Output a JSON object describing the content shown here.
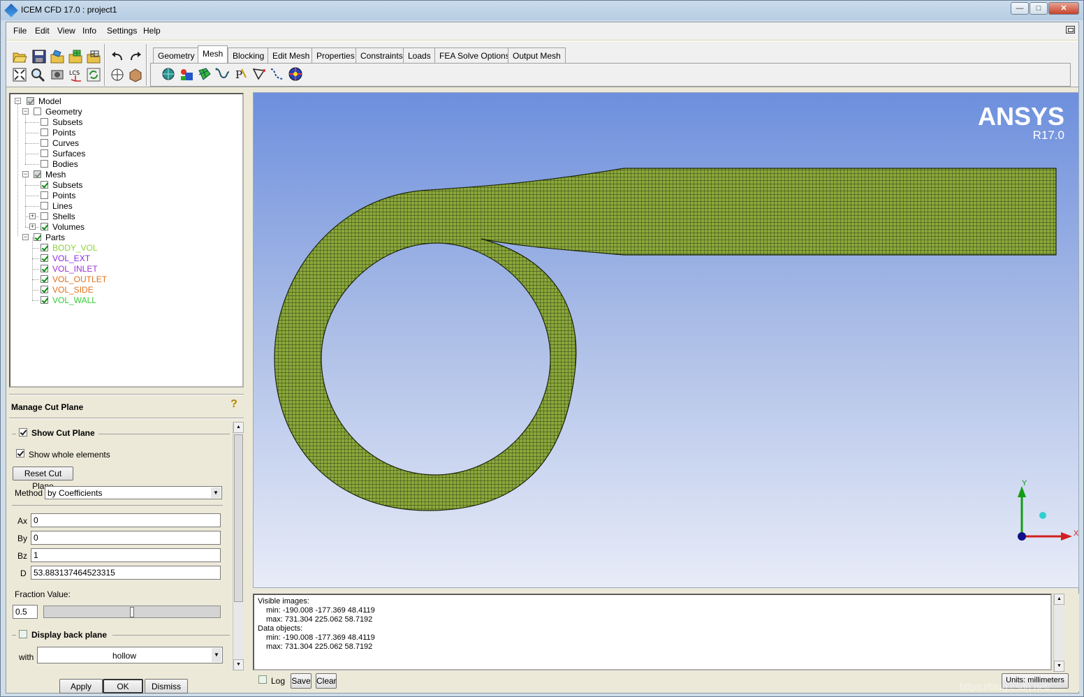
{
  "window": {
    "title": "ICEM CFD 17.0 : project1",
    "buttons": {
      "minimize": "—",
      "maximize": "□",
      "close": "✕"
    }
  },
  "menu": [
    "File",
    "Edit",
    "View",
    "Info",
    "Settings",
    "Help"
  ],
  "tabs": [
    "Geometry",
    "Mesh",
    "Blocking",
    "Edit Mesh",
    "Properties",
    "Constraints",
    "Loads",
    "FEA Solve Options",
    "Output Mesh"
  ],
  "active_tab": "Mesh",
  "tree": {
    "model": "Model",
    "geometry": "Geometry",
    "geometry_items": [
      "Subsets",
      "Points",
      "Curves",
      "Surfaces",
      "Bodies"
    ],
    "mesh": "Mesh",
    "mesh_items": [
      "Subsets",
      "Points",
      "Lines",
      "Shells",
      "Volumes"
    ],
    "parts": "Parts",
    "part_items": [
      {
        "name": "BODY_VOL",
        "color": "#8bd23a"
      },
      {
        "name": "VOL_EXT",
        "color": "#8a2be2"
      },
      {
        "name": "VOL_INLET",
        "color": "#9b30d8"
      },
      {
        "name": "VOL_OUTLET",
        "color": "#e0701c"
      },
      {
        "name": "VOL_SIDE",
        "color": "#e0701c"
      },
      {
        "name": "VOL_WALL",
        "color": "#32cd32"
      }
    ]
  },
  "panel": {
    "title": "Manage Cut Plane",
    "show_cut_plane": "Show Cut Plane",
    "show_whole_elements": "Show whole elements",
    "reset_button": "Reset Cut Plane",
    "method_label": "Method",
    "method_value": "by Coefficients",
    "fields": [
      {
        "label": "Ax",
        "value": "0"
      },
      {
        "label": "By",
        "value": "0"
      },
      {
        "label": "Bz",
        "value": "1"
      },
      {
        "label": "D",
        "value": "53.883137464523315"
      }
    ],
    "fraction_label": "Fraction Value:",
    "fraction_value": "0.5",
    "fraction_slider": 0.5,
    "display_back_plane": "Display back plane",
    "with_label": "with",
    "with_value": "hollow",
    "buttons": {
      "apply": "Apply",
      "ok": "OK",
      "dismiss": "Dismiss"
    }
  },
  "viewport": {
    "brand": "ANSYS",
    "version": "R17.0",
    "axis_y": "Y",
    "axis_x": "X",
    "mesh_color": "#8aa83a"
  },
  "console": {
    "lines": [
      "Visible images:",
      "min: -190.008 -177.369 48.4119",
      "max: 731.304 225.062 58.7192",
      "Data objects:",
      "min: -190.008 -177.369 48.4119",
      "max: 731.304 225.062 58.7192"
    ],
    "log_label": "Log",
    "save_label": "Save",
    "clear_label": "Clear",
    "units": "Units: millimeters"
  },
  "watermark": "https://blog.csdn.net/..."
}
